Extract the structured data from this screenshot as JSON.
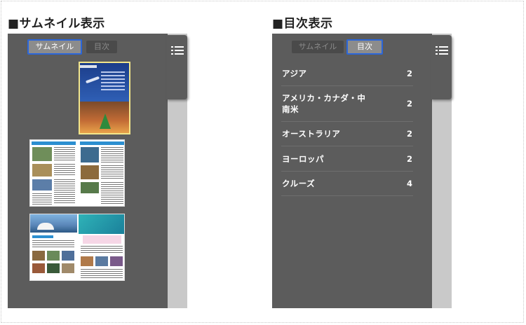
{
  "left_section": {
    "title": "■サムネイル表示",
    "toggle": {
      "thumbnail_label": "サムネイル",
      "toc_label": "目次",
      "active": "thumbnail"
    },
    "menu_icon": "list-icon"
  },
  "right_section": {
    "title": "■目次表示",
    "toggle": {
      "thumbnail_label": "サムネイル",
      "toc_label": "目次",
      "active": "toc"
    },
    "menu_icon": "list-icon",
    "toc_items": [
      {
        "label": "アジア",
        "count": "2"
      },
      {
        "label": "アメリカ・カナダ・中南米",
        "count": "2"
      },
      {
        "label": "オーストラリア",
        "count": "2"
      },
      {
        "label": "ヨーロッパ",
        "count": "2"
      },
      {
        "label": "クルーズ",
        "count": "4"
      }
    ]
  },
  "colors": {
    "panel_bg": "#5c5c5c",
    "active_border": "#2b66d9",
    "selected_thumb_border": "#f2e58a"
  }
}
